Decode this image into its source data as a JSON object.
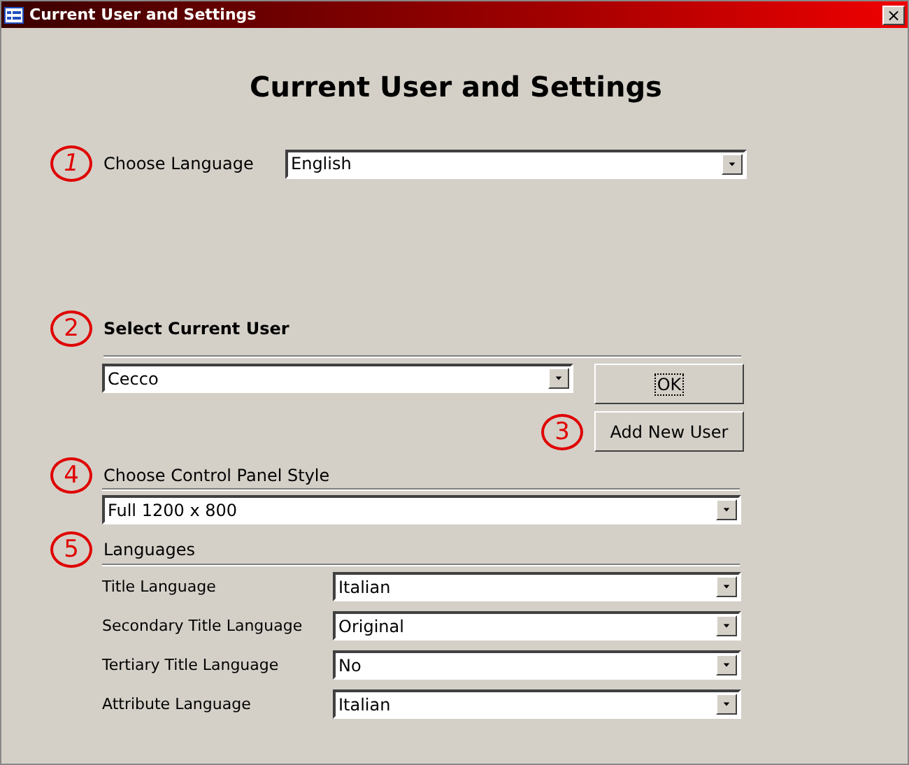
{
  "window": {
    "title": "Current User and Settings",
    "close": "×"
  },
  "heading": "Current User and Settings",
  "language": {
    "marker": "1",
    "label": "Choose Language",
    "value": "English"
  },
  "user": {
    "marker": "2",
    "label": "Select Current User",
    "value": "Cecco",
    "ok_button": "OK",
    "add_marker": "3",
    "add_button": "Add New User"
  },
  "panel_style": {
    "marker": "4",
    "label": "Choose Control Panel Style",
    "value": "Full 1200 x 800"
  },
  "languages": {
    "marker": "5",
    "label": "Languages",
    "rows": [
      {
        "label": "Title Language",
        "value": "Italian"
      },
      {
        "label": "Secondary Title Language",
        "value": "Original"
      },
      {
        "label": "Tertiary Title Language",
        "value": "No"
      },
      {
        "label": "Attribute Language",
        "value": "Italian"
      }
    ]
  }
}
